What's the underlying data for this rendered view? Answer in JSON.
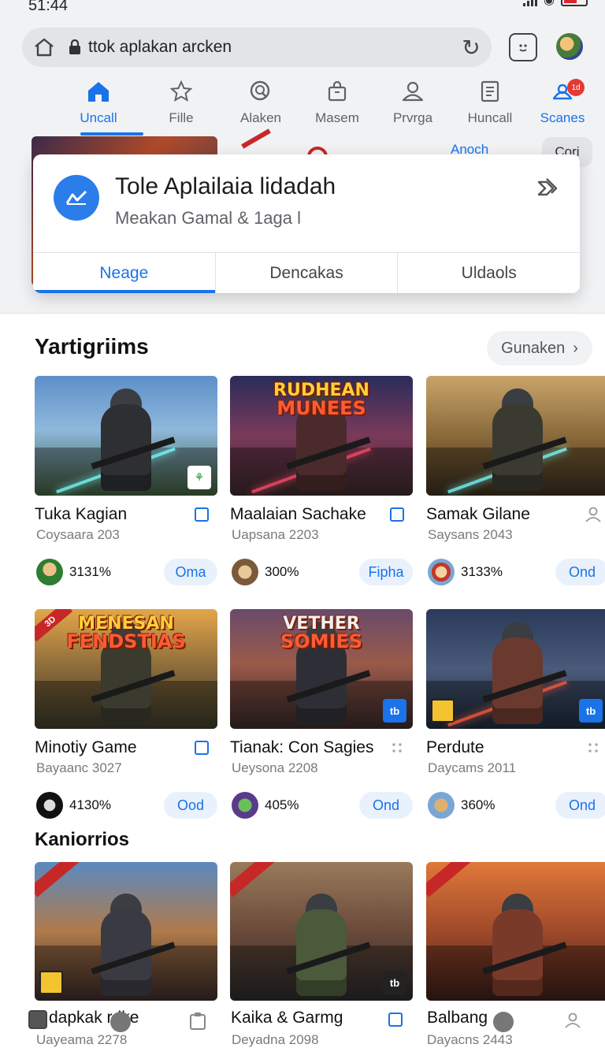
{
  "status": {
    "time": "51:44"
  },
  "browser": {
    "url": "ttok aplakan arcken"
  },
  "nav": {
    "items": [
      {
        "label": "Uncall",
        "icon": "home-icon"
      },
      {
        "label": "Fille",
        "icon": "star-icon"
      },
      {
        "label": "Alaken",
        "icon": "search-icon"
      },
      {
        "label": "Masem",
        "icon": "bag-icon"
      },
      {
        "label": "Prvrga",
        "icon": "person-icon"
      },
      {
        "label": "Huncall",
        "icon": "list-icon"
      },
      {
        "label": "Scanes",
        "icon": "notification-icon",
        "badge": "1d"
      }
    ]
  },
  "background": {
    "link": "Anoch",
    "chip": "Cori"
  },
  "popup": {
    "title": "Tole Aplailaia lidadah",
    "subtitle": "Meakan Gamal  &  1aga l",
    "tabs": [
      "Neage",
      "Dencakas",
      "Uldaols"
    ]
  },
  "section1": {
    "title": "Yartigriims",
    "more_label": "Gunaken"
  },
  "section2": {
    "title": "Kaniorrios"
  },
  "games": [
    {
      "name": "Tuka Kagian",
      "sub": "Coysaara 203",
      "pct": "3131%",
      "btn": "Oma",
      "thumb_title": "",
      "thumb_title2": "",
      "corner": ""
    },
    {
      "name": "Maalaian Sachake",
      "sub": "Uapsana 2203",
      "pct": "300%",
      "btn": "Fipha",
      "thumb_title": "RUDHEAN",
      "thumb_title2": "MUNEES",
      "corner": ""
    },
    {
      "name": "Samak Gilane",
      "sub": "Saysans 2043",
      "pct": "3133%",
      "btn": "Ond",
      "thumb_title": "",
      "thumb_title2": "",
      "corner": ""
    },
    {
      "name": "Minotiy Game",
      "sub": "Bayaanc 3027",
      "pct": "4130%",
      "btn": "Ood",
      "thumb_title": "MENESAN",
      "thumb_title2": "FENDSTIAS",
      "corner": "3D"
    },
    {
      "name": "Tianak: Con Sagies",
      "sub": "Ueysona 2208",
      "pct": "405%",
      "btn": "Ond",
      "thumb_title": "VETHER",
      "thumb_title2": "SOMIES",
      "corner": ""
    },
    {
      "name": "Perdute",
      "sub": "Daycams 2011",
      "pct": "360%",
      "btn": "Ond",
      "thumb_title": "",
      "thumb_title2": "",
      "corner": ""
    },
    {
      "name": "dapkak rdke",
      "sub": "Uayeama 2278",
      "pct": "",
      "btn": "",
      "thumb_title": "",
      "thumb_title2": "",
      "corner": ""
    },
    {
      "name": "Kaika & Garmg",
      "sub": "Deyadna 2098",
      "pct": "",
      "btn": "",
      "thumb_title": "",
      "thumb_title2": "",
      "corner": ""
    },
    {
      "name": "Balbang",
      "sub": "Dayacns 2443",
      "pct": "",
      "btn": "",
      "thumb_title": "",
      "thumb_title2": "",
      "corner": ""
    }
  ],
  "colors": {
    "accent": "#1a73e8",
    "badge_red": "#e53935"
  }
}
